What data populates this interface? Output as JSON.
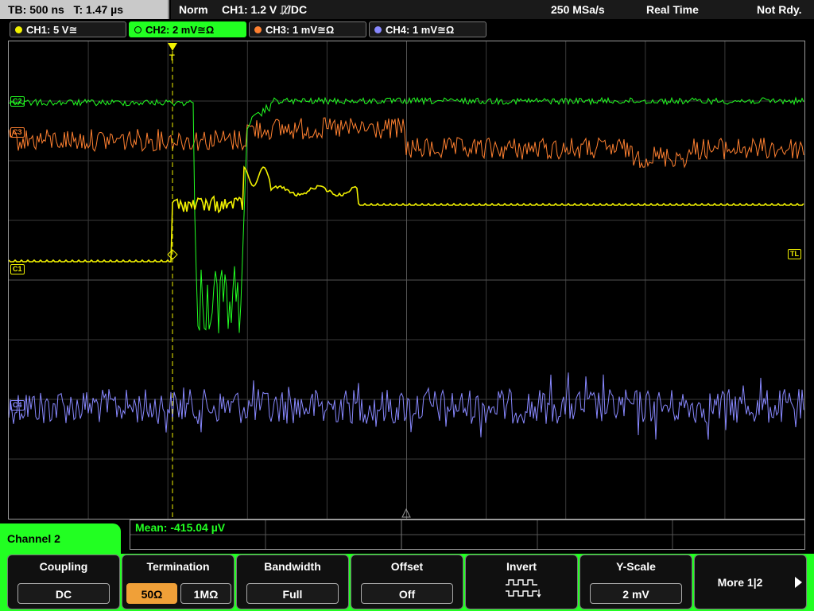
{
  "status": {
    "timebase": "TB: 500 ns",
    "trigger_time": "T: 1.47 µs",
    "mode": "Norm",
    "trigger": "CH1: 1.2 V ⎍̸/DC",
    "sample_rate": "250 MSa/s",
    "acq_mode": "Real Time",
    "ready": "Not Rdy."
  },
  "channels": [
    {
      "label": "CH1: 5 V≅",
      "color": "#f2f200"
    },
    {
      "label": "CH2: 2 mV≅Ω",
      "color": "#22ff22"
    },
    {
      "label": "CH3: 1 mV≅Ω",
      "color": "#ff8030"
    },
    {
      "label": "CH4: 1 mV≅Ω",
      "color": "#8888ff"
    }
  ],
  "markers": {
    "c1": "C1",
    "c2": "C2",
    "c3": "C3",
    "c4": "C4",
    "trigger_level": "TL",
    "trigger_pos": "T"
  },
  "measurement": {
    "mean": "Mean: -415.04 µV"
  },
  "menu_title": "Channel 2",
  "softkeys": {
    "coupling": {
      "title": "Coupling",
      "value": "DC"
    },
    "termination": {
      "title": "Termination",
      "options": [
        "50Ω",
        "1MΩ"
      ],
      "selected": "50Ω"
    },
    "bandwidth": {
      "title": "Bandwidth",
      "value": "Full"
    },
    "offset": {
      "title": "Offset",
      "value": "Off"
    },
    "invert": {
      "title": "Invert",
      "icon": "invert-waveform-icon"
    },
    "yscale": {
      "title": "Y-Scale",
      "value": "2 mV"
    },
    "more": {
      "title": "More 1|2",
      "icon": "play-arrow-icon"
    }
  },
  "colors": {
    "accent": "#22ff22",
    "ch1": "#f2f200",
    "ch2": "#22ff22",
    "ch3": "#ff8030",
    "ch4": "#8888ff",
    "selected": "#f0a038"
  }
}
